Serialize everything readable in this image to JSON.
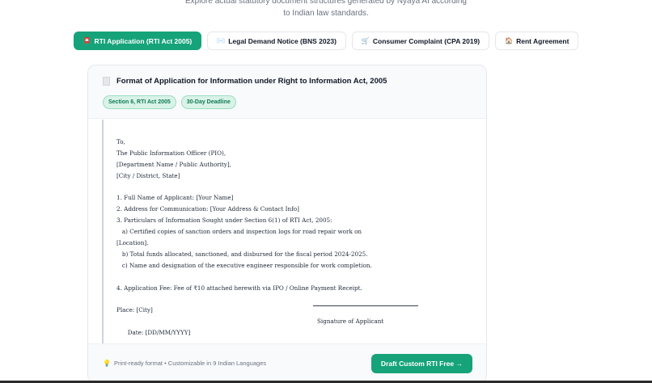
{
  "intro": {
    "line1": "Explore actual statutory document structures generated by Nyaya AI according",
    "line2": "to Indian law standards."
  },
  "tabs": [
    {
      "icon": "📮",
      "label": "RTI Application (RTI Act 2005)",
      "active": true
    },
    {
      "icon": "✉️",
      "label": "Legal Demand Notice (BNS 2023)",
      "active": false
    },
    {
      "icon": "🛒",
      "label": "Consumer Complaint (CPA 2019)",
      "active": false
    },
    {
      "icon": "🏠",
      "label": "Rent Agreement",
      "active": false
    }
  ],
  "card": {
    "title": "Format of Application for Information under Right to Information Act, 2005",
    "badges": [
      "Section 6, RTI Act 2005",
      "30-Day Deadline"
    ],
    "lines": [
      "To,",
      "The Public Information Officer (PIO),",
      "[Department Name / Public Authority],",
      "[City / District, State]",
      "",
      "1. Full Name of Applicant: [Your Name]",
      "2. Address for Communication: [Your Address & Contact Info]",
      "3. Particulars of Information Sought under Section 6(1) of RTI Act, 2005:",
      "   a) Certified copies of sanction orders and inspection logs for road repair work on",
      "[Location].",
      "   b) Total funds allocated, sanctioned, and disbursed for the fiscal period 2024-2025.",
      "   c) Name and designation of the executive engineer responsible for work completion.",
      "",
      "4. Application Fee: Fee of ₹10 attached herewith via IPO / Online Payment Receipt.",
      "",
      "Place: [City]"
    ],
    "date_line": "Date: [DD/MM/YYYY]",
    "signature": "Signature of Applicant",
    "footer_note": "Print-ready format • Customizable in 9 Indian Languages",
    "cta_label": "Draft Custom RTI Free →"
  },
  "colors": {
    "accent": "#16a37a",
    "badge_bg": "#d9f3e8"
  }
}
